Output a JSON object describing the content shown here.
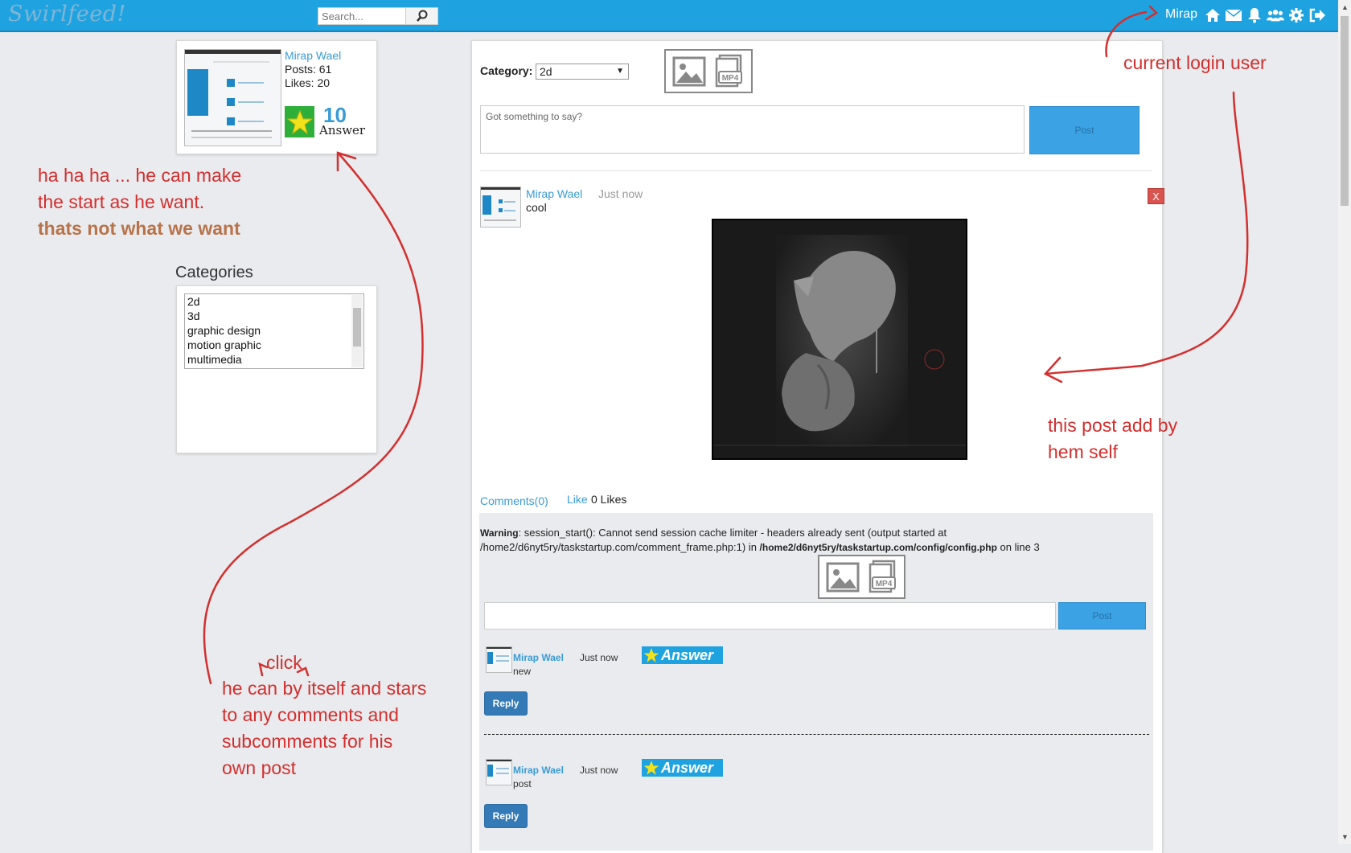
{
  "header": {
    "logo": "Swirlfeed!",
    "search_placeholder": "Search...",
    "username": "Mirap",
    "icons": [
      "home-icon",
      "envelope-icon",
      "bell-icon",
      "users-icon",
      "gear-icon",
      "logout-icon"
    ]
  },
  "profile": {
    "name": "Mirap Wael",
    "posts": "Posts: 61",
    "likes": "Likes: 20",
    "answer_count": "10",
    "answer_label": "Answer"
  },
  "categories": {
    "title": "Categories",
    "items": [
      "2d",
      "3d",
      "graphic design",
      "motion graphic",
      "multimedia"
    ]
  },
  "composer": {
    "category_label": "Category:",
    "category_value": "2d",
    "placeholder": "Got something to say?",
    "post_label": "Post"
  },
  "post": {
    "author": "Mirap Wael",
    "time": "Just now",
    "text": "cool",
    "delete_label": "X",
    "comments_link": "Comments(0)",
    "like_link": "Like",
    "likes_count": "0 Likes"
  },
  "comment_frame": {
    "warning_label": "Warning",
    "warning_text": ": session_start(): Cannot send session cache limiter - headers already sent (output started at /home2/d6nyt5ry/taskstartup.com/comment_frame.php:1) in ",
    "warning_path": "/home2/d6nyt5ry/taskstartup.com/config/config.php",
    "warning_line": " on line 3",
    "post_label": "Post",
    "comments": [
      {
        "author": "Mirap Wael",
        "time": "Just now",
        "text": "new",
        "badge": "Answer",
        "reply": "Reply"
      },
      {
        "author": "Mirap Wael",
        "time": "Just now",
        "text": "post",
        "badge": "Answer",
        "reply": "Reply"
      }
    ]
  },
  "annotations": {
    "current_user": "current login user",
    "star_note_1": "ha ha ha ... he can make",
    "star_note_2": "the start as he want.",
    "star_note_3": "thats not what we want",
    "post_note_1": "this post add by",
    "post_note_2": "hem self",
    "click": "click",
    "comment_note_1": "he can by itself and stars",
    "comment_note_2": "to any comments and",
    "comment_note_3": "subcomments for his",
    "comment_note_4": "own post"
  },
  "colors": {
    "topbar": "#1fa3e0",
    "link": "#3a9bd5",
    "annotation": "#d32f2f",
    "reply": "#337ab7",
    "delete": "#d9534f"
  }
}
